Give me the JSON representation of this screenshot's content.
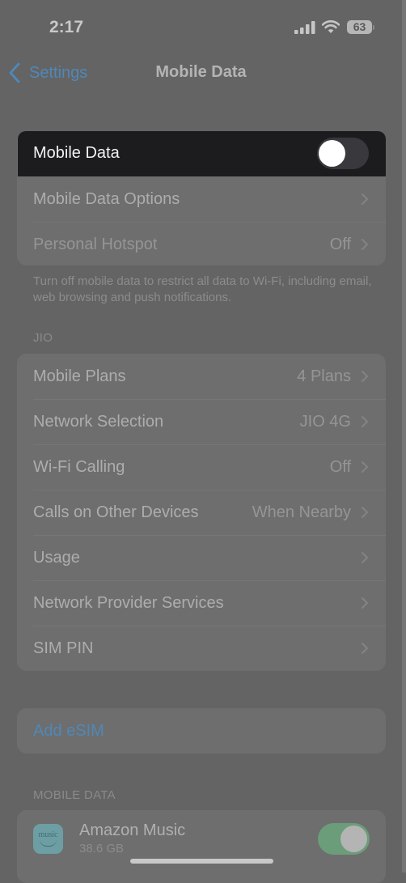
{
  "status_bar": {
    "time": "2:17",
    "signal_icon": "cellular-signal-icon",
    "wifi_icon": "wifi-icon",
    "battery_level": "63"
  },
  "nav": {
    "back_label": "Settings",
    "title": "Mobile Data"
  },
  "mobile_data_section": {
    "toggle_row": {
      "label": "Mobile Data",
      "state": "off"
    },
    "rows": [
      {
        "label": "Mobile Data Options",
        "value": ""
      },
      {
        "label": "Personal Hotspot",
        "value": "Off"
      }
    ],
    "footer": "Turn off mobile data to restrict all data to Wi-Fi, including email, web browsing and push notifications."
  },
  "jio_section": {
    "header": "JIO",
    "rows": [
      {
        "label": "Mobile Plans",
        "value": "4 Plans"
      },
      {
        "label": "Network Selection",
        "value": "JIO 4G"
      },
      {
        "label": "Wi-Fi Calling",
        "value": "Off"
      },
      {
        "label": "Calls on Other Devices",
        "value": "When Nearby"
      },
      {
        "label": "Usage",
        "value": ""
      },
      {
        "label": "Network Provider Services",
        "value": ""
      },
      {
        "label": "SIM PIN",
        "value": ""
      }
    ]
  },
  "esim": {
    "label": "Add eSIM"
  },
  "apps_section": {
    "header": "MOBILE DATA",
    "apps": [
      {
        "name": "Amazon Music",
        "usage": "38.6 GB",
        "icon_text": "music",
        "enabled": true
      }
    ]
  },
  "colors": {
    "accent": "#4f88b8",
    "toggle_on": "#6c9d7a",
    "highlight_row": "#1c1c1e"
  }
}
